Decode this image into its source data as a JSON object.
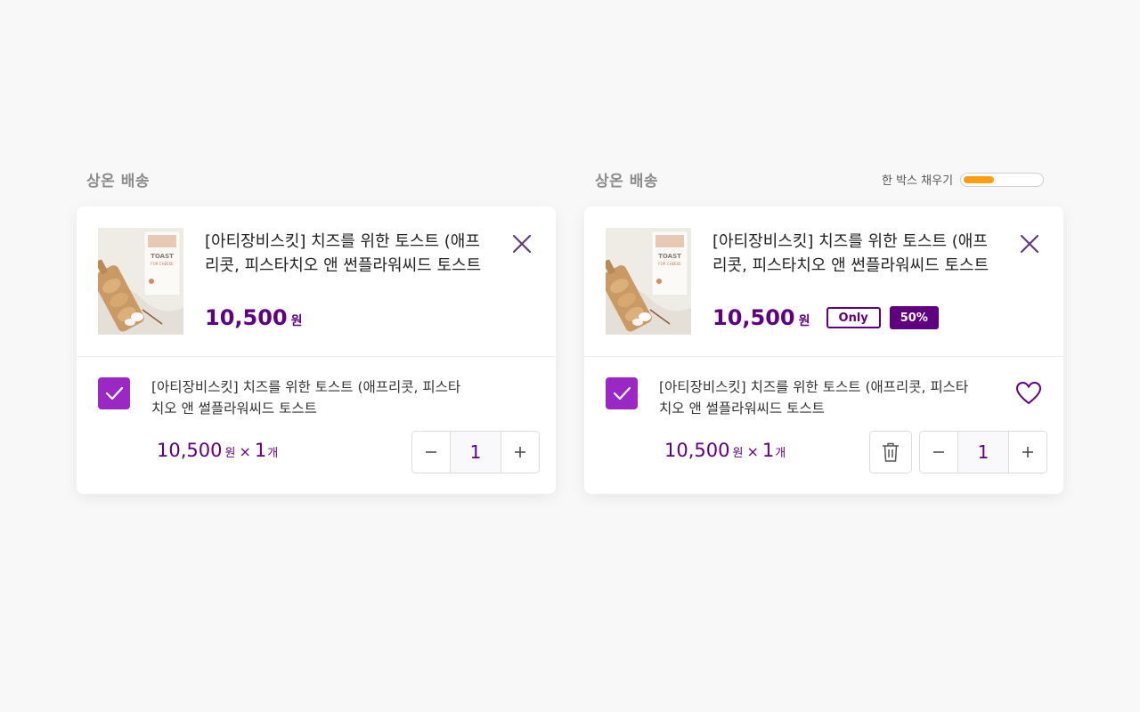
{
  "left": {
    "section_label": "상온 배송",
    "product_name": "[아티장비스킷] 치즈를 위한 토스트 (애프리콧, 피스타치오 앤 썬플라워씨드 토스트",
    "price": "10,500",
    "currency": "원",
    "option_name": "[아티장비스킷] 치즈를 위한 토스트 (애프리콧, 피스타치오 앤 썰플라워씨드 토스트",
    "option_price": "10,500",
    "option_currency": "원",
    "times": "×",
    "option_qty": "1",
    "option_unit": "개",
    "quantity": "1",
    "checked": true
  },
  "right": {
    "section_label": "상온 배송",
    "fill_box_label": "한 박스 채우기",
    "fill_box_progress": 0.4,
    "product_name": "[아티장비스킷] 치즈를 위한 토스트 (애프리콧, 피스타치오 앤 썬플라워씨드 토스트",
    "price": "10,500",
    "currency": "원",
    "badge_only": "Only",
    "badge_sale": "50%",
    "option_name": "[아티장비스킷] 치즈를 위한 토스트 (애프리콧, 피스타치오 앤 썰플라워씨드 토스트",
    "option_price": "10,500",
    "option_currency": "원",
    "times": "×",
    "option_qty": "1",
    "option_unit": "개",
    "quantity": "1",
    "checked": true
  },
  "icons": {
    "close": "close-icon",
    "check": "check-icon",
    "minus": "minus-icon",
    "plus": "plus-icon",
    "trash": "trash-icon",
    "heart": "heart-icon"
  },
  "colors": {
    "brand": "#5f0080",
    "checkbox": "#9b27c4",
    "progress": "#ff9f0f"
  }
}
